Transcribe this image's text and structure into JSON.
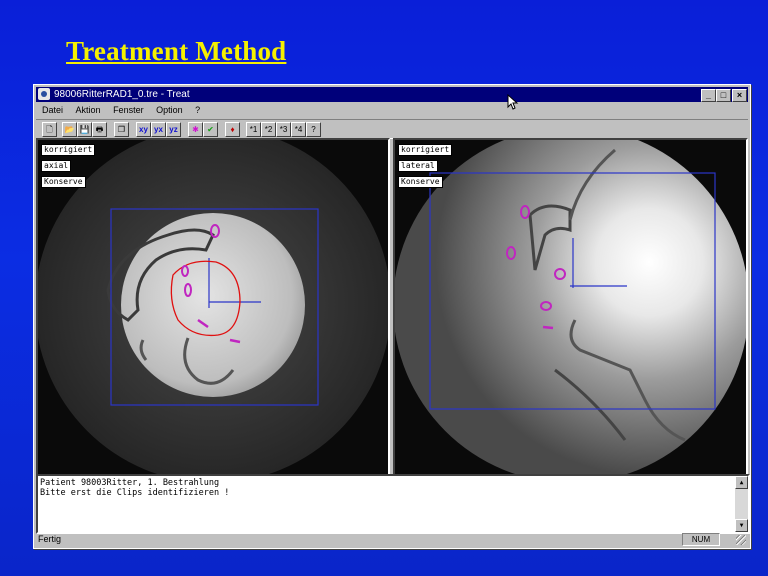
{
  "slide": {
    "title": "Treatment Method"
  },
  "window": {
    "title": "98006RitterRAD1_0.tre - Treat",
    "controls": {
      "minimize": "_",
      "maximize": "□",
      "close": "×"
    }
  },
  "menu": {
    "items": [
      "Datei",
      "Aktion",
      "Fenster",
      "Option",
      "?"
    ]
  },
  "toolbar": {
    "buttons": [
      {
        "name": "new-icon",
        "glyph": "🗋"
      },
      {
        "name": "open-icon",
        "glyph": "📂"
      },
      {
        "name": "save-icon",
        "glyph": "💾"
      },
      {
        "name": "print-icon",
        "glyph": "🖶"
      },
      {
        "name": "window-icon",
        "glyph": "❐"
      },
      {
        "name": "xy-view-icon",
        "glyph": "xy"
      },
      {
        "name": "yx-view-icon",
        "glyph": "yx"
      },
      {
        "name": "yz-view-icon",
        "glyph": "yz"
      },
      {
        "name": "clip-tool-icon",
        "glyph": "✱"
      },
      {
        "name": "check-icon",
        "glyph": "✔"
      },
      {
        "name": "marker-icon",
        "glyph": "♦"
      },
      {
        "name": "marker-1-icon",
        "glyph": "*1"
      },
      {
        "name": "marker-2-icon",
        "glyph": "*2"
      },
      {
        "name": "marker-3-icon",
        "glyph": "*3"
      },
      {
        "name": "marker-4-icon",
        "glyph": "*4"
      },
      {
        "name": "help-icon",
        "glyph": "?"
      }
    ]
  },
  "left_panel": {
    "labels": [
      "korrigiert",
      "axial",
      "Konserve"
    ]
  },
  "right_panel": {
    "labels": [
      "korrigiert",
      "lateral",
      "Konserve"
    ]
  },
  "log": {
    "lines": [
      "Patient 98003Ritter, 1. Bestrahlung",
      "Bitte erst die Clips identifizieren !"
    ]
  },
  "status": {
    "left": "Fertig",
    "num": "NUM"
  },
  "colors": {
    "slide_bg": "#0a1fd8",
    "title": "#f5f000",
    "titlebar": "#00007a",
    "clip_marker": "#c026c0",
    "contour": "#e01010",
    "box": "#2b35c8"
  }
}
